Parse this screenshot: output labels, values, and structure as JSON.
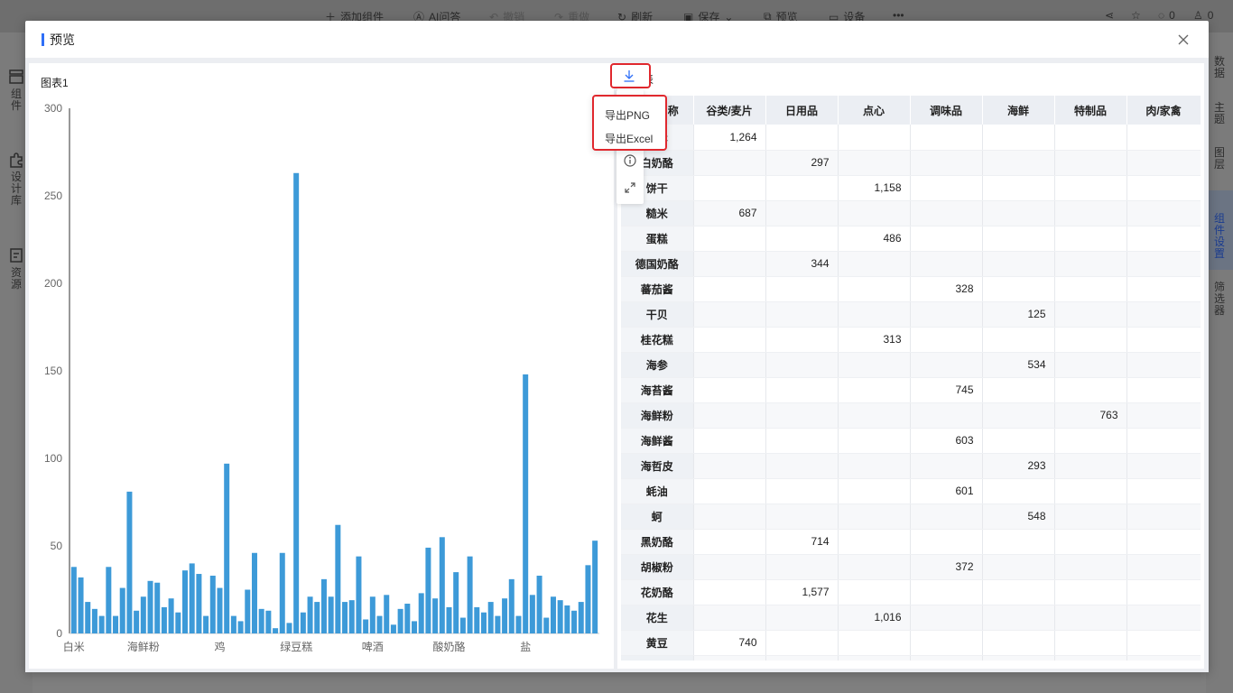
{
  "topbar": {
    "add_component": "添加组件",
    "ai_qa": "AI问答",
    "undo": "撤销",
    "redo": "重做",
    "refresh": "刷新",
    "save": "保存",
    "preview": "预览",
    "device": "设备",
    "more": "•••",
    "comment_count": "0",
    "like_count": "0"
  },
  "left_rail": {
    "components": "组件",
    "design_lib": "设计库",
    "resources": "资源"
  },
  "right_rail": {
    "data": "数据",
    "theme": "主题",
    "layers": "图层",
    "component_settings": "组件设置",
    "filter": "筛选器"
  },
  "modal": {
    "title": "预览"
  },
  "chart_panel": {
    "title": "图表1"
  },
  "table_panel": {
    "title": "表2",
    "title_prefix_hidden": "表"
  },
  "export_menu": {
    "png": "导出PNG",
    "excel": "导出Excel"
  },
  "chart_data": {
    "type": "bar",
    "title": "图表1",
    "ylim": [
      0,
      300
    ],
    "yticks": [
      0,
      50,
      100,
      150,
      200,
      250,
      300
    ],
    "xtick_labels": [
      "白米",
      "海鲜粉",
      "鸡",
      "绿豆糕",
      "啤酒",
      "酸奶酪",
      "盐"
    ],
    "xtick_indices": [
      0,
      10,
      21,
      32,
      43,
      54,
      65
    ],
    "grid": false,
    "color": "#3d9ad8",
    "values": [
      38,
      32,
      18,
      14,
      10,
      38,
      10,
      26,
      81,
      13,
      21,
      30,
      29,
      15,
      20,
      12,
      36,
      40,
      34,
      10,
      33,
      26,
      97,
      10,
      7,
      25,
      46,
      14,
      13,
      3,
      46,
      6,
      263,
      12,
      21,
      18,
      31,
      21,
      62,
      18,
      19,
      44,
      8,
      21,
      10,
      22,
      5,
      14,
      17,
      7,
      23,
      49,
      20,
      55,
      15,
      35,
      9,
      44,
      15,
      12,
      18,
      10,
      20,
      31,
      10,
      148,
      22,
      33,
      9,
      21,
      19,
      16,
      13,
      18,
      39,
      53
    ]
  },
  "table": {
    "headers": [
      "产品名称",
      "谷类/麦片",
      "日用品",
      "点心",
      "调味品",
      "海鲜",
      "特制品",
      "肉/家禽"
    ],
    "rows": [
      [
        "白米",
        "1,264",
        "",
        "",
        "",
        "",
        "",
        ""
      ],
      [
        "白奶酪",
        "",
        "297",
        "",
        "",
        "",
        "",
        ""
      ],
      [
        "饼干",
        "",
        "",
        "1,158",
        "",
        "",
        "",
        ""
      ],
      [
        "糙米",
        "687",
        "",
        "",
        "",
        "",
        "",
        ""
      ],
      [
        "蛋糕",
        "",
        "",
        "486",
        "",
        "",
        "",
        ""
      ],
      [
        "德国奶酪",
        "",
        "344",
        "",
        "",
        "",
        "",
        ""
      ],
      [
        "蕃茄酱",
        "",
        "",
        "",
        "328",
        "",
        "",
        ""
      ],
      [
        "干贝",
        "",
        "",
        "",
        "",
        "125",
        "",
        ""
      ],
      [
        "桂花糕",
        "",
        "",
        "313",
        "",
        "",
        "",
        ""
      ],
      [
        "海参",
        "",
        "",
        "",
        "",
        "534",
        "",
        ""
      ],
      [
        "海苔酱",
        "",
        "",
        "",
        "745",
        "",
        "",
        ""
      ],
      [
        "海鲜粉",
        "",
        "",
        "",
        "",
        "",
        "763",
        ""
      ],
      [
        "海鲜酱",
        "",
        "",
        "",
        "603",
        "",
        "",
        ""
      ],
      [
        "海哲皮",
        "",
        "",
        "",
        "",
        "293",
        "",
        ""
      ],
      [
        "蚝油",
        "",
        "",
        "",
        "601",
        "",
        "",
        ""
      ],
      [
        "蚵",
        "",
        "",
        "",
        "",
        "548",
        "",
        ""
      ],
      [
        "黑奶酪",
        "",
        "714",
        "",
        "",
        "",
        "",
        ""
      ],
      [
        "胡椒粉",
        "",
        "",
        "",
        "372",
        "",
        "",
        ""
      ],
      [
        "花奶酪",
        "",
        "1,577",
        "",
        "",
        "",
        "",
        ""
      ],
      [
        "花生",
        "",
        "",
        "1,016",
        "",
        "",
        "",
        ""
      ],
      [
        "黄豆",
        "740",
        "",
        "",
        "",
        "",
        "",
        ""
      ],
      [
        "",
        "",
        "",
        "",
        "",
        "",
        "",
        ""
      ]
    ]
  }
}
